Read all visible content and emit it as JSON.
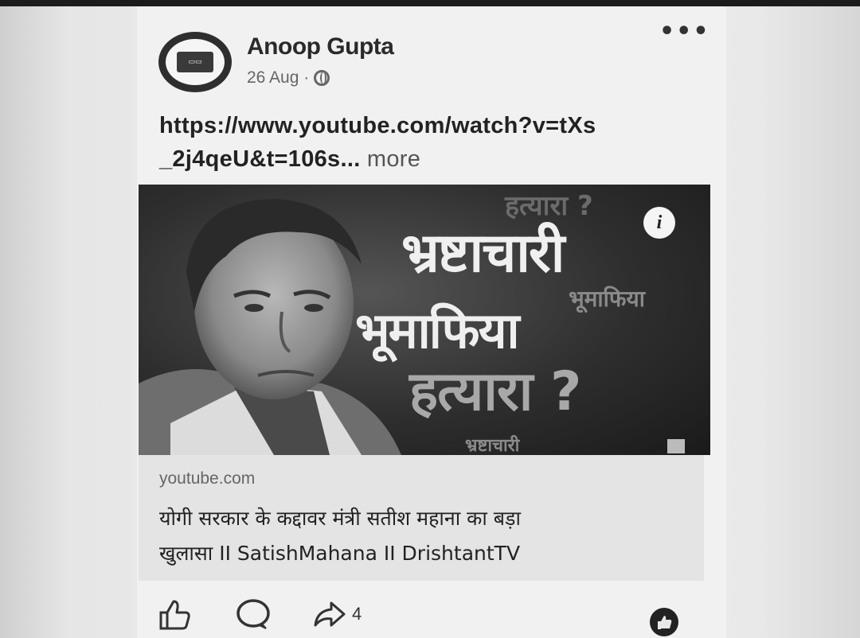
{
  "post": {
    "author": "Anoop Gupta",
    "date": "26 Aug ·",
    "privacy_icon": "globe-icon",
    "menu_label": "•••",
    "text_line1": "https://www.youtube.com/watch?v=tXs",
    "text_line2": "_2j4qeU&t=106s",
    "text_ellipsis": "...",
    "text_more": "more"
  },
  "video": {
    "headline_1": "भ्रष्टाचारी",
    "headline_2": "भूमाफिया",
    "headline_3": "हत्यारा ?",
    "ghost_1": "हत्यारा ?",
    "ghost_2": "भूमाफिया",
    "ghost_3": "भ्रष्टाचारी",
    "info_icon_label": "i"
  },
  "link_preview": {
    "domain": "youtube.com",
    "title_line1": "योगी सरकार के कद्दावर मंत्री सतीश महाना का बड़ा",
    "title_line2": "खुलासा II SatishMahana II DrishtantTV"
  },
  "actions": {
    "like_icon": "thumbs-up-icon",
    "comment_icon": "comment-icon",
    "share_icon": "share-icon",
    "share_count": "4"
  },
  "colors": {
    "page_background": "#eeeeee",
    "text_primary": "#222222",
    "text_secondary": "#666666"
  }
}
